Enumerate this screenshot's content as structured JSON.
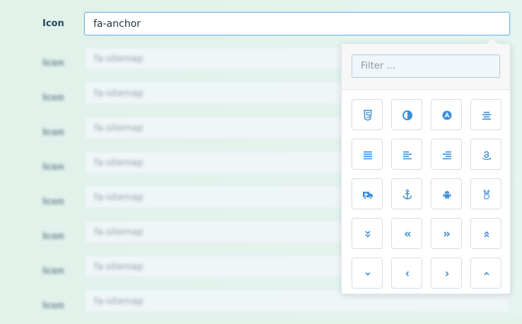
{
  "form": {
    "active_row": {
      "label": "Icon",
      "value": "fa-anchor"
    },
    "blurred_rows": [
      {
        "label": "Icon",
        "value": "fa-sitemap"
      },
      {
        "label": "Icon",
        "value": "fa-sitemap"
      },
      {
        "label": "Icon",
        "value": "fa-sitemap"
      },
      {
        "label": "Icon",
        "value": "fa-sitemap"
      },
      {
        "label": "Icon",
        "value": "fa-sitemap"
      },
      {
        "label": "Icon",
        "value": "fa-sitemap"
      },
      {
        "label": "Icon",
        "value": "fa-sitemap"
      },
      {
        "label": "Icon",
        "value": "fa-sitemap"
      }
    ]
  },
  "picker": {
    "filter_placeholder": "Filter ...",
    "icons": [
      [
        "html5-icon",
        "adjust-icon",
        "adn-icon",
        "align-center-icon"
      ],
      [
        "align-justify-icon",
        "align-left-icon",
        "align-right-icon",
        "amazon-icon"
      ],
      [
        "ambulance-icon",
        "anchor-icon",
        "android-icon",
        "angellist-icon"
      ],
      [
        "angle-double-down-icon",
        "angle-double-left-icon",
        "angle-double-right-icon",
        "angle-double-up-icon"
      ],
      [
        "angle-down-icon",
        "angle-left-icon",
        "angle-right-icon",
        "angle-up-icon"
      ]
    ]
  },
  "colors": {
    "accent": "#3d8fd8",
    "background": "#e2f3ec"
  }
}
